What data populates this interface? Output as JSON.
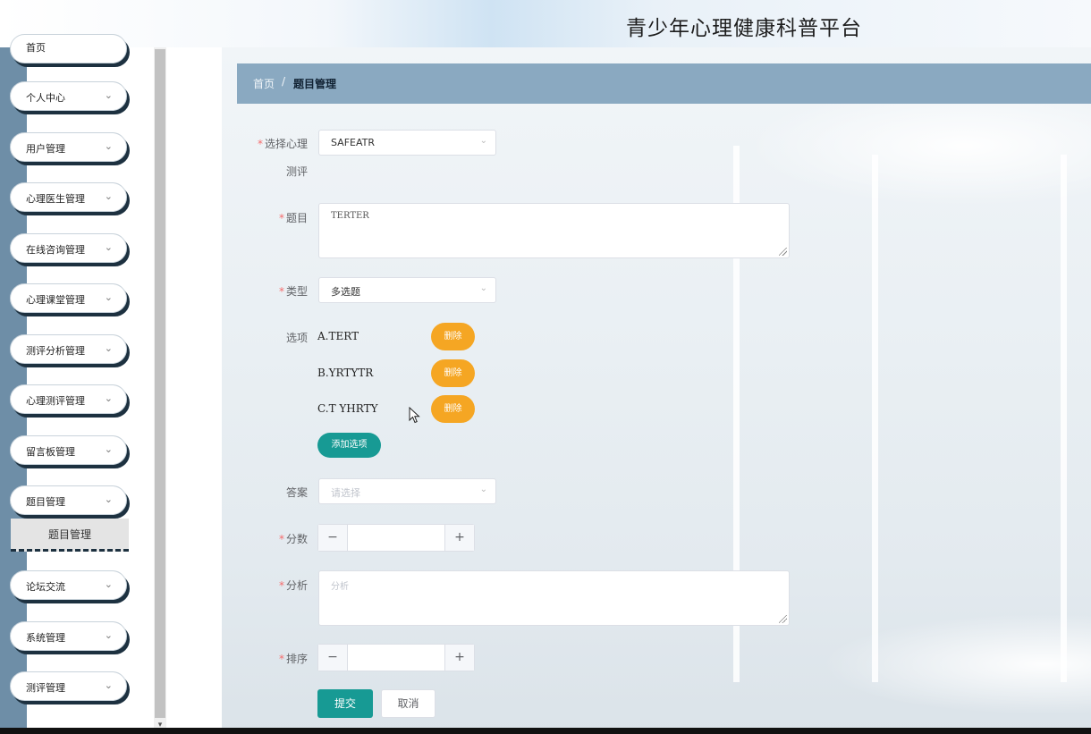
{
  "app": {
    "title": "青少年心理健康科普平台"
  },
  "sidebar": {
    "items": [
      {
        "label": "首页"
      },
      {
        "label": "个人中心"
      },
      {
        "label": "用户管理"
      },
      {
        "label": "心理医生管理"
      },
      {
        "label": "在线咨询管理"
      },
      {
        "label": "心理课堂管理"
      },
      {
        "label": "测评分析管理"
      },
      {
        "label": "心理测评管理"
      },
      {
        "label": "留言板管理"
      },
      {
        "label": "题目管理"
      },
      {
        "label": "论坛交流"
      },
      {
        "label": "系统管理"
      },
      {
        "label": "测评管理"
      }
    ],
    "submenu": {
      "label": "题目管理"
    },
    "chevron": "⌄"
  },
  "breadcrumb": {
    "home": "首页",
    "separator": "/",
    "current": "题目管理"
  },
  "form": {
    "assessment": {
      "label": "选择心理测评",
      "label_line1": "选择心理",
      "label_line2": "测评",
      "value": "SAFEATR"
    },
    "question": {
      "label": "题目",
      "value": "TERTER"
    },
    "type": {
      "label": "类型",
      "value": "多选题"
    },
    "options": {
      "label": "选项",
      "items": [
        {
          "text": "A.TERT",
          "delete_label": "删除"
        },
        {
          "text": "B.YRTYTR",
          "delete_label": "删除"
        },
        {
          "text": "C.T YHRTY",
          "delete_label": "删除"
        }
      ],
      "add_label": "添加选项"
    },
    "answer": {
      "label": "答案",
      "placeholder": "请选择"
    },
    "score": {
      "label": "分数",
      "value": ""
    },
    "analysis": {
      "label": "分析",
      "placeholder": "分析"
    },
    "sort": {
      "label": "排序",
      "value": ""
    },
    "submit_label": "提交",
    "cancel_label": "取消"
  },
  "colors": {
    "primary": "#179a94",
    "warning": "#f5a623",
    "required": "#f56c6c",
    "breadcrumb_bar": "#8aa9c1",
    "sidebar_accent": "#6e8ea7"
  },
  "icons": {
    "chevron_down": "⌄",
    "minus": "−",
    "plus": "+"
  }
}
